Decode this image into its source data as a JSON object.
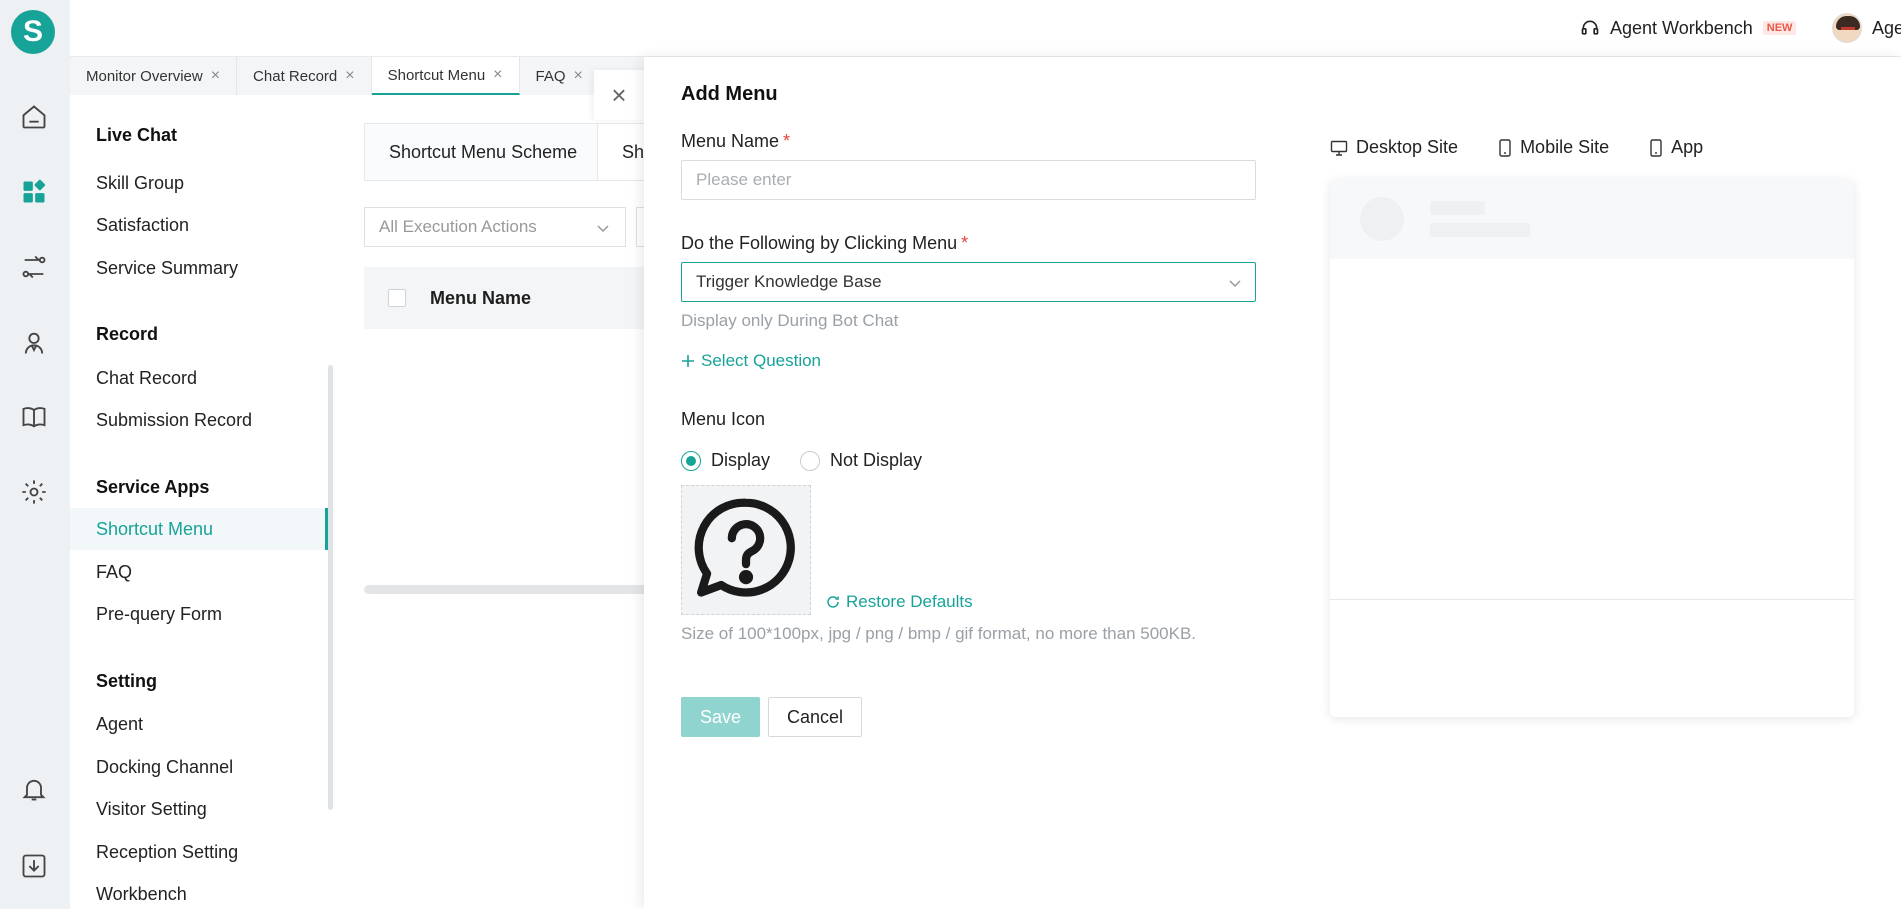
{
  "app": {
    "logo_letter": "S"
  },
  "topbar": {
    "workbench_label": "Agent Workbench",
    "new_badge": "NEW",
    "agent_label": "Agent"
  },
  "tabs": [
    {
      "label": "Monitor Overview"
    },
    {
      "label": "Chat Record"
    },
    {
      "label": "Shortcut Menu"
    },
    {
      "label": "FAQ"
    }
  ],
  "sidebar": {
    "groups": [
      {
        "title": "Live Chat",
        "items": [
          "Skill Group",
          "Satisfaction",
          "Service Summary"
        ]
      },
      {
        "title": "Record",
        "items": [
          "Chat Record",
          "Submission Record"
        ]
      },
      {
        "title": "Service Apps",
        "items": [
          "Shortcut Menu",
          "FAQ",
          "Pre-query Form"
        ]
      },
      {
        "title": "Setting",
        "items": [
          "Agent",
          "Docking Channel",
          "Visitor Setting",
          "Reception Setting",
          "Workbench"
        ]
      }
    ]
  },
  "background": {
    "tab1": "Shortcut Menu Scheme",
    "tab2_partial": "Sh",
    "filter_placeholder": "All Execution Actions",
    "table_header": "Menu Name"
  },
  "drawer": {
    "title": "Add Menu",
    "menu_name_label": "Menu Name",
    "menu_name_placeholder": "Please enter",
    "required_mark": "*",
    "action_label": "Do the Following by Clicking Menu",
    "action_value": "Trigger Knowledge Base",
    "action_hint": "Display only During Bot Chat",
    "select_question": "Select Question",
    "icon_label": "Menu Icon",
    "radio_display": "Display",
    "radio_not_display": "Not Display",
    "restore_defaults": "Restore Defaults",
    "size_hint": "Size of 100*100px, jpg / png / bmp / gif format, no more than 500KB.",
    "save": "Save",
    "cancel": "Cancel"
  },
  "preview": {
    "tabs": [
      {
        "label": "Desktop Site",
        "icon": "desktop-icon"
      },
      {
        "label": "Mobile Site",
        "icon": "mobile-icon"
      },
      {
        "label": "App",
        "icon": "app-icon"
      }
    ]
  },
  "colors": {
    "accent": "#17a398",
    "required": "#e8413a"
  }
}
